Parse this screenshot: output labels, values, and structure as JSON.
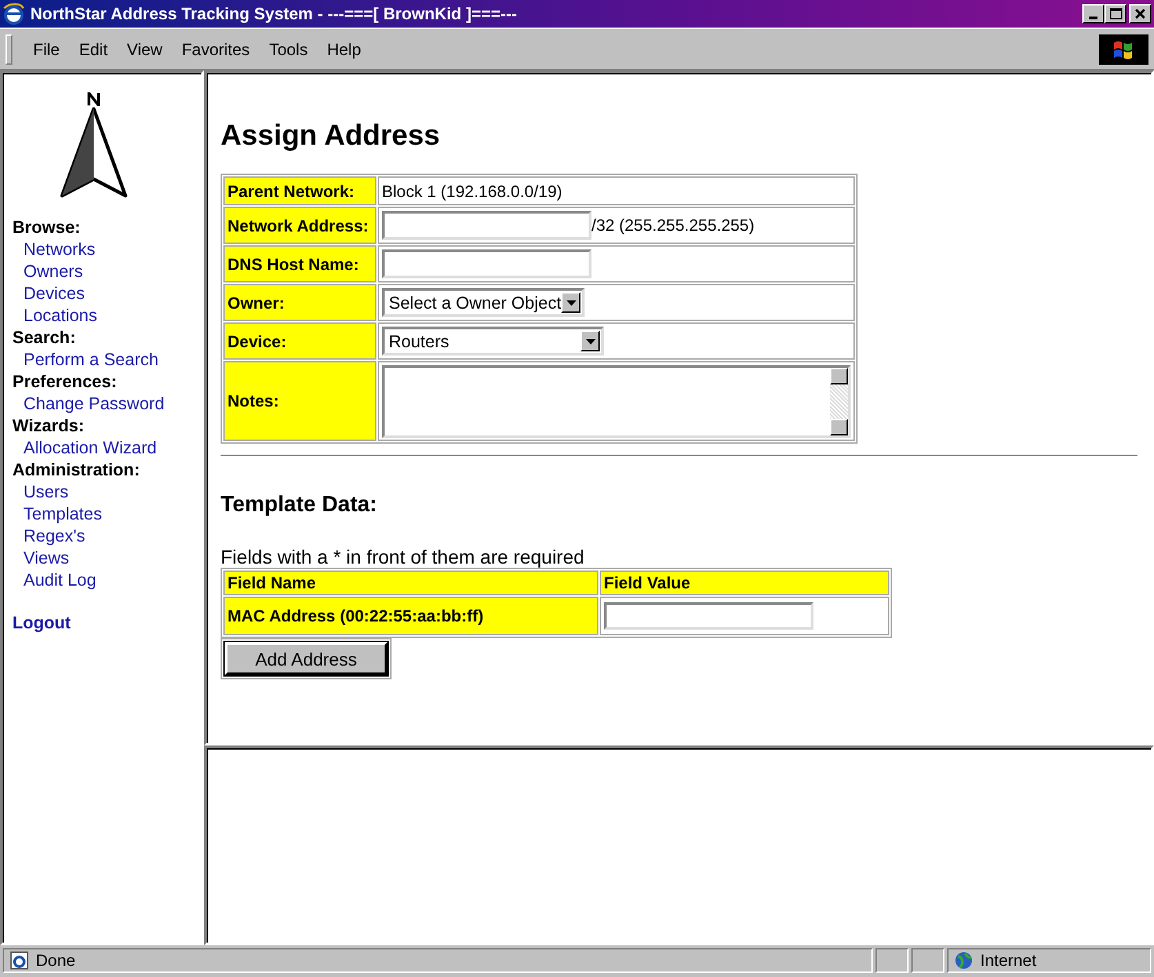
{
  "window": {
    "title": "NorthStar Address Tracking System - ---===[ BrownKid ]===---"
  },
  "menu": [
    "File",
    "Edit",
    "View",
    "Favorites",
    "Tools",
    "Help"
  ],
  "sidebar": {
    "sections": [
      {
        "heading": "Browse:",
        "links": [
          "Networks",
          "Owners",
          "Devices",
          "Locations"
        ]
      },
      {
        "heading": "Search:",
        "links": [
          "Perform a Search"
        ]
      },
      {
        "heading": "Preferences:",
        "links": [
          "Change Password"
        ]
      },
      {
        "heading": "Wizards:",
        "links": [
          "Allocation Wizard"
        ]
      },
      {
        "heading": "Administration:",
        "links": [
          "Users",
          "Templates",
          "Regex's",
          "Views",
          "Audit Log"
        ]
      }
    ],
    "logout": "Logout"
  },
  "form": {
    "title": "Assign Address",
    "rows": [
      {
        "label": "Parent Network:",
        "kind": "text",
        "value": "Block 1 (192.168.0.0/19)"
      },
      {
        "label": "Network Address:",
        "kind": "input",
        "suffix": "/32 (255.255.255.255)"
      },
      {
        "label": "DNS Host Name:",
        "kind": "input"
      },
      {
        "label": "Owner:",
        "kind": "select",
        "value": "Select a Owner Object"
      },
      {
        "label": "Device:",
        "kind": "select",
        "value": "Routers"
      },
      {
        "label": "Notes:",
        "kind": "textarea"
      }
    ]
  },
  "template": {
    "title": "Template Data:",
    "note": "Fields with a * in front of them are required",
    "columns": [
      "Field Name",
      "Field Value"
    ],
    "rows": [
      {
        "name": "MAC Address (00:22:55:aa:bb:ff)"
      }
    ],
    "button": "Add Address"
  },
  "status_bar": {
    "text": "Done",
    "zone": "Internet"
  }
}
